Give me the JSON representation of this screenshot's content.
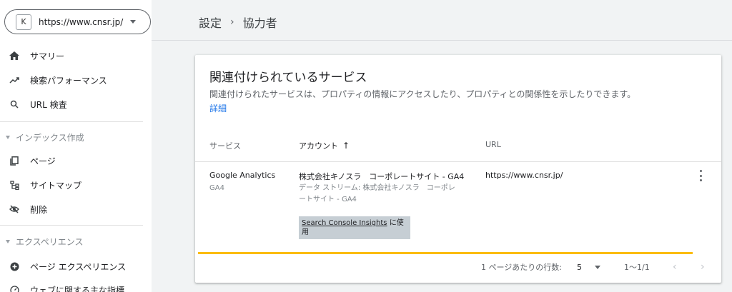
{
  "property": {
    "logo_text": "K",
    "url": "https://www.cnsr.jp/"
  },
  "nav": {
    "summary": "サマリー",
    "performance": "検索パフォーマンス",
    "url_inspection": "URL 検査",
    "indexing_section": "インデックス作成",
    "pages": "ページ",
    "sitemaps": "サイトマップ",
    "removals": "削除",
    "experience_section": "エクスペリエンス",
    "page_experience": "ページ エクスペリエンス",
    "web_vitals": "ウェブに関する主な指標"
  },
  "breadcrumb": {
    "parent": "設定",
    "separator": "›",
    "current": "協力者"
  },
  "card": {
    "title": "関連付けられているサービス",
    "description": "関連付けられたサービスは、プロパティの情報にアクセスしたり、プロパティとの関係性を示したりできます。",
    "details_link": "詳細"
  },
  "table": {
    "headers": {
      "service": "サービス",
      "account": "アカウント",
      "url": "URL"
    },
    "rows": [
      {
        "service": "Google Analytics",
        "service_sub": "GA4",
        "account": "株式会社キノスラ　コーポレートサイト - GA4",
        "account_sub_line1": "データ ストリーム: 株式会社キノスラ　コーポレ",
        "account_sub_line2": "ートサイト - GA4",
        "chip_link": "Search Console Insights",
        "chip_suffix_line1": " に使",
        "chip_suffix_line2": "用",
        "url": "https://www.cnsr.jp/"
      }
    ]
  },
  "pagination": {
    "rows_per_page_label": "1 ページあたりの行数:",
    "rows_per_page_value": "5",
    "range": "1〜1/1",
    "prev": "‹",
    "next": "›"
  },
  "colors": {
    "highlight": "#fbbc04",
    "link": "#1a73e8",
    "chip_bg": "#c6ced4"
  }
}
